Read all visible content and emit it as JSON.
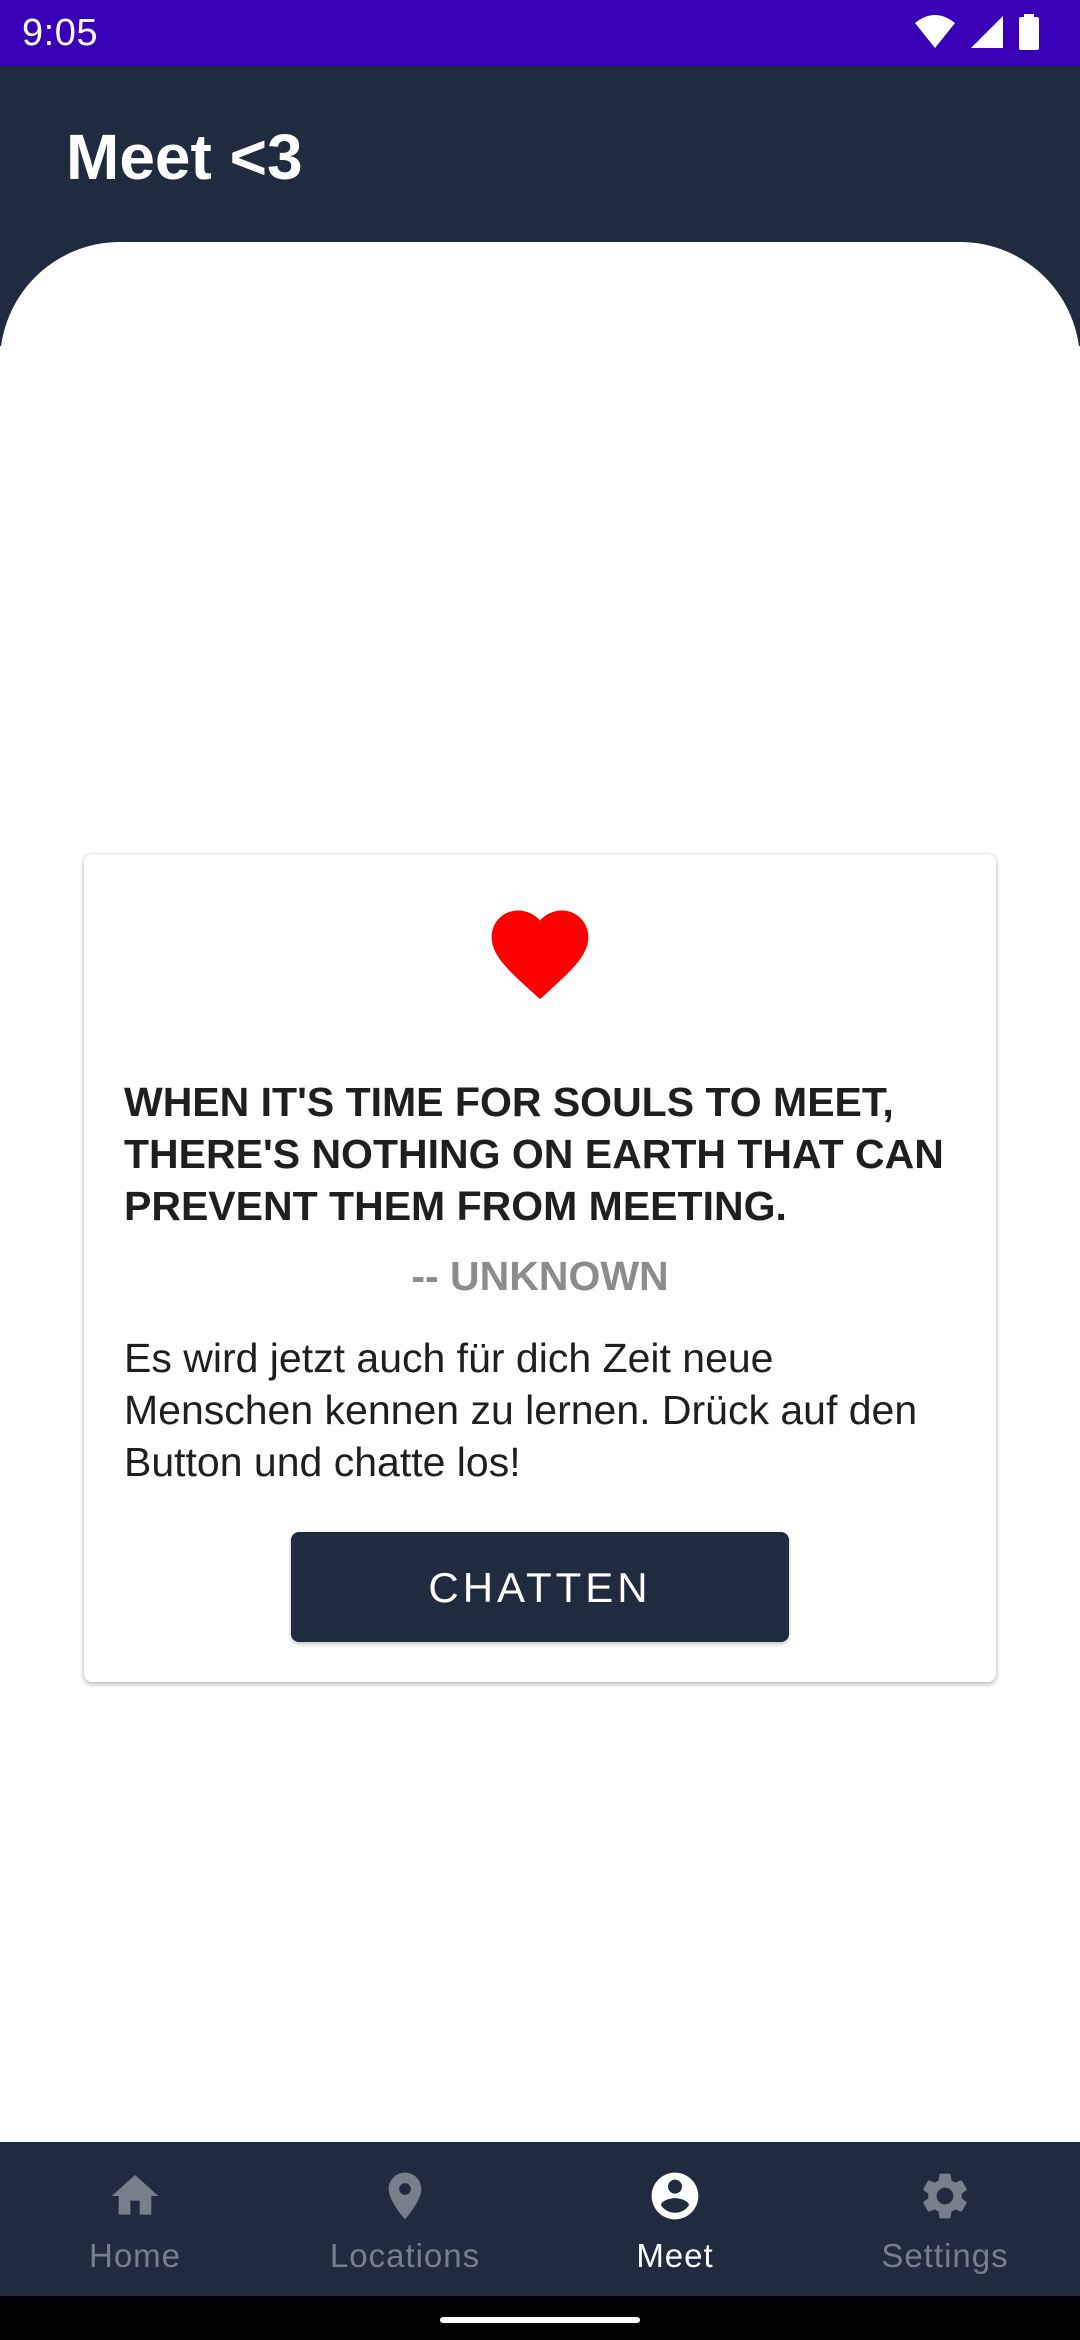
{
  "status_bar": {
    "time": "9:05",
    "icons": [
      "wifi-icon",
      "cell-signal-icon",
      "battery-icon"
    ],
    "background": "#3A00B8"
  },
  "app_bar": {
    "title": "Meet <3",
    "background": "#212B3F"
  },
  "card": {
    "icon": "heart-icon",
    "icon_color": "#FF0000",
    "quote": "WHEN IT'S TIME FOR SOULS TO MEET, THERE'S NOTHING ON EARTH THAT CAN PREVENT THEM FROM MEETING.",
    "author": "-- UNKNOWN",
    "description": "Es wird jetzt auch für dich Zeit neue Menschen kennen zu lernen. Drück auf den Button und chatte los!",
    "button_label": "CHATTEN"
  },
  "bottom_nav": {
    "items": [
      {
        "label": "Home",
        "icon": "home-icon",
        "active": false
      },
      {
        "label": "Locations",
        "icon": "location-pin-icon",
        "active": false
      },
      {
        "label": "Meet",
        "icon": "account-circle-icon",
        "active": true
      },
      {
        "label": "Settings",
        "icon": "gear-icon",
        "active": false
      }
    ],
    "active_color": "#FFFFFF",
    "inactive_color": "#777F8C"
  }
}
